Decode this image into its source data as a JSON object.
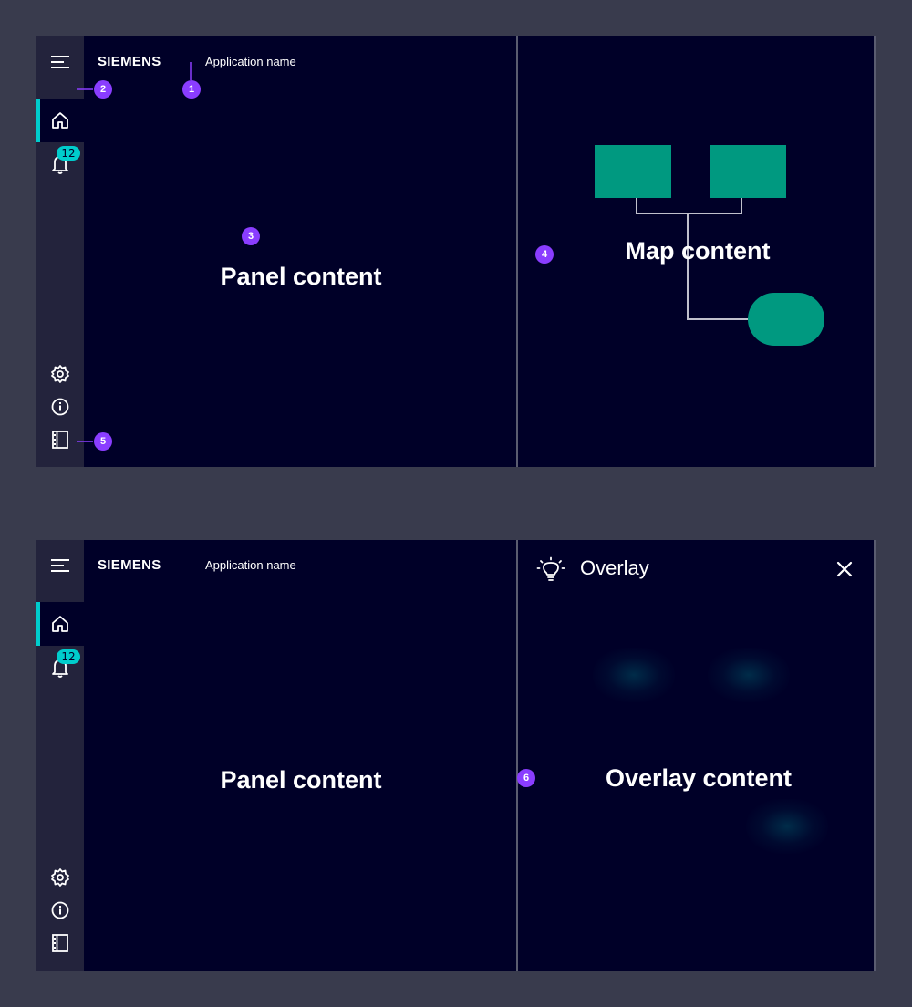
{
  "brand": "SIEMENS",
  "app_name": "Application name",
  "notification_count": "12",
  "icons": {
    "menu": "hamburger-menu-icon",
    "home": "home-icon",
    "notifications": "bell-icon",
    "settings": "gear-icon",
    "info": "info-icon",
    "panel_toggle": "panel-toggle-icon",
    "overlay": "lightbulb-icon",
    "close": "close-icon"
  },
  "colors": {
    "background": "#393b4d",
    "content_bg": "#000028",
    "sidebar_bg": "#23233c",
    "accent": "#00cccc",
    "map_shapes": "#009999",
    "marker": "#8a3dff"
  },
  "example_1": {
    "panel_label": "Panel content",
    "map_label": "Map content",
    "markers": [
      "1",
      "2",
      "3",
      "4",
      "5"
    ]
  },
  "example_2": {
    "panel_label": "Panel content",
    "overlay_title": "Overlay",
    "overlay_label": "Overlay content",
    "markers": [
      "6"
    ]
  }
}
